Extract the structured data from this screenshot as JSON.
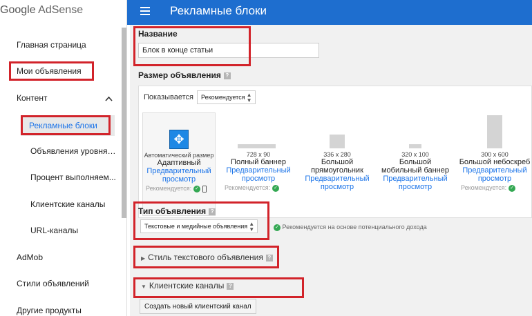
{
  "app": {
    "logo_google": "Google",
    "logo_product": "AdSense"
  },
  "header": {
    "title": "Рекламные блоки"
  },
  "sidebar": {
    "items": [
      {
        "label": "Главная страница"
      },
      {
        "label": "Мои объявления"
      },
      {
        "label": "Контент"
      },
      {
        "label": "Рекламные блоки"
      },
      {
        "label": "Объявления уровня с..."
      },
      {
        "label": "Процент выполняем..."
      },
      {
        "label": "Клиентские каналы"
      },
      {
        "label": "URL-каналы"
      },
      {
        "label": "AdMob"
      },
      {
        "label": "Стили объявлений"
      },
      {
        "label": "Другие продукты"
      }
    ]
  },
  "form": {
    "name_label": "Название",
    "name_value": "Блок в конце статьи",
    "size_label": "Размер объявления",
    "help": "?",
    "shown_label": "Показывается",
    "shown_select": "Рекомендуется",
    "options": [
      {
        "size": "Автоматический размер",
        "name": "Адаптивный",
        "link": "Предварительный просмотр",
        "rec": "Рекомендуется:"
      },
      {
        "size": "728 x 90",
        "name": "Полный баннер",
        "link": "Предварительный просмотр",
        "rec": "Рекомендуется:"
      },
      {
        "size": "336 x 280",
        "name": "Большой прямоугольник",
        "link": "Предварительный просмотр",
        "rec": ""
      },
      {
        "size": "320 x 100",
        "name": "Большой мобильный баннер",
        "link": "Предварительный просмотр",
        "rec": ""
      },
      {
        "size": "300 x 600",
        "name": "Большой небоскреб",
        "link": "Предварительный просмотр",
        "rec": "Рекомендуется:"
      }
    ],
    "type_label": "Тип объявления",
    "type_select": "Текстовые и медийные объявления",
    "type_note": "Рекомендуется на основе потенциального дохода",
    "text_style_label": "Стиль текстового объявления",
    "channels_label": "Клиентские каналы",
    "create_channel_button": "Создать новый клиентский канал"
  }
}
